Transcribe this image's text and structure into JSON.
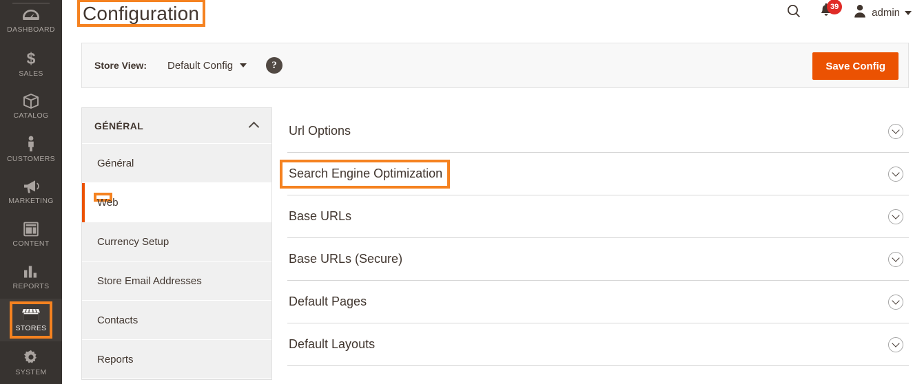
{
  "colors": {
    "accent_orange": "#eb5202",
    "highlight_orange": "#f58220",
    "rail_bg": "#373330",
    "badge_red": "#e02b27",
    "text_dark": "#41362f",
    "panel_gray": "#f0f0f0"
  },
  "rail": {
    "items": [
      {
        "label": "DASHBOARD",
        "icon": "dashboard-gauge-icon",
        "active": false,
        "highlighted": false
      },
      {
        "label": "SALES",
        "icon": "dollar-sign-icon",
        "active": false,
        "highlighted": false
      },
      {
        "label": "CATALOG",
        "icon": "box-icon",
        "active": false,
        "highlighted": false
      },
      {
        "label": "CUSTOMERS",
        "icon": "person-icon",
        "active": false,
        "highlighted": false
      },
      {
        "label": "MARKETING",
        "icon": "megaphone-icon",
        "active": false,
        "highlighted": false
      },
      {
        "label": "CONTENT",
        "icon": "layout-page-icon",
        "active": false,
        "highlighted": false
      },
      {
        "label": "REPORTS",
        "icon": "bar-chart-icon",
        "active": false,
        "highlighted": false
      },
      {
        "label": "STORES",
        "icon": "storefront-icon",
        "active": true,
        "highlighted": true
      },
      {
        "label": "SYSTEM",
        "icon": "gear-icon",
        "active": false,
        "highlighted": false
      }
    ]
  },
  "header": {
    "title": "Configuration",
    "search_icon": "search-icon",
    "notifications": {
      "icon": "bell-icon",
      "count": "39"
    },
    "user": {
      "icon": "user-avatar-icon",
      "name": "admin",
      "caret": "chevron-down-icon"
    }
  },
  "storeview": {
    "label": "Store View:",
    "selected": "Default Config",
    "caret": "chevron-down-icon",
    "help_icon": "question-mark-icon",
    "help_glyph": "?",
    "save_label": "Save Config"
  },
  "config_nav": {
    "section_title": "GÉNÉRAL",
    "collapse_icon": "chevron-up-icon",
    "items": [
      {
        "label": "Général",
        "active": false,
        "highlighted": false
      },
      {
        "label": "Web",
        "active": true,
        "highlighted": true
      },
      {
        "label": "Currency Setup",
        "active": false,
        "highlighted": false
      },
      {
        "label": "Store Email Addresses",
        "active": false,
        "highlighted": false
      },
      {
        "label": "Contacts",
        "active": false,
        "highlighted": false
      },
      {
        "label": "Reports",
        "active": false,
        "highlighted": false
      }
    ]
  },
  "sections": [
    {
      "title": "Url Options",
      "toggle_icon": "chevron-down-circle-icon",
      "highlighted": false
    },
    {
      "title": "Search Engine Optimization",
      "toggle_icon": "chevron-down-circle-icon",
      "highlighted": true
    },
    {
      "title": "Base URLs",
      "toggle_icon": "chevron-down-circle-icon",
      "highlighted": false
    },
    {
      "title": "Base URLs (Secure)",
      "toggle_icon": "chevron-down-circle-icon",
      "highlighted": false
    },
    {
      "title": "Default Pages",
      "toggle_icon": "chevron-down-circle-icon",
      "highlighted": false
    },
    {
      "title": "Default Layouts",
      "toggle_icon": "chevron-down-circle-icon",
      "highlighted": false
    }
  ]
}
